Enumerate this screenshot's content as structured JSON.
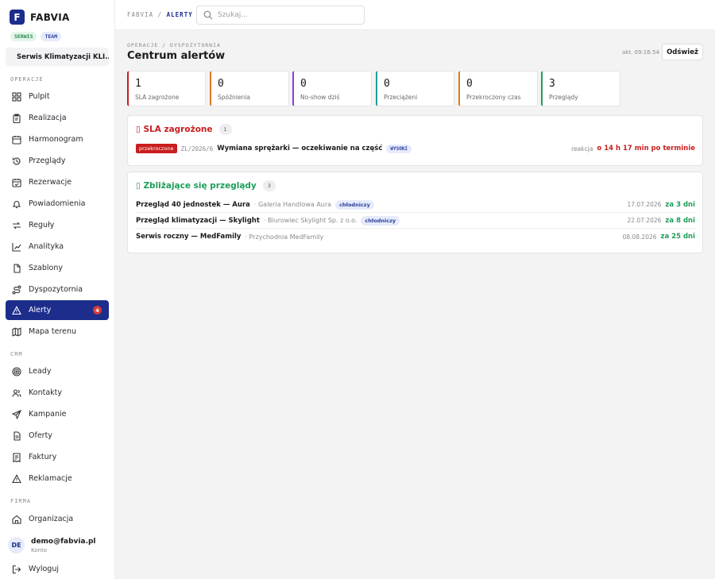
{
  "sidebar": {
    "brand": {
      "logo": "F",
      "name": "FABVIA"
    },
    "tags": [
      "SERWIS",
      "TEAM"
    ],
    "org": "Serwis Klimatyzacji KLI...",
    "sections": {
      "operacje": "OPERACJE",
      "crm": "CRM",
      "firma": "FIRMA"
    },
    "items": [
      {
        "label": "Pulpit",
        "icon": "grid-icon"
      },
      {
        "label": "Realizacja",
        "icon": "clipboard-icon"
      },
      {
        "label": "Harmonogram",
        "icon": "calendar-icon"
      },
      {
        "label": "Przeglądy",
        "icon": "history-icon"
      },
      {
        "label": "Rezerwacje",
        "icon": "calendar-check-icon"
      },
      {
        "label": "Powiadomienia",
        "icon": "bell-icon"
      },
      {
        "label": "Reguły",
        "icon": "rules-icon"
      },
      {
        "label": "Analityka",
        "icon": "chart-icon"
      },
      {
        "label": "Szablony",
        "icon": "template-icon"
      },
      {
        "label": "Dyspozytornia",
        "icon": "route-icon"
      },
      {
        "label": "Alerty",
        "icon": "warning-icon",
        "badge": "4"
      },
      {
        "label": "Mapa terenu",
        "icon": "map-icon"
      },
      {
        "label": "Leady",
        "icon": "target-icon"
      },
      {
        "label": "Kontakty",
        "icon": "users-icon"
      },
      {
        "label": "Kampanie",
        "icon": "send-icon"
      },
      {
        "label": "Oferty",
        "icon": "document-icon"
      },
      {
        "label": "Faktury",
        "icon": "invoice-icon"
      },
      {
        "label": "Reklamacje",
        "icon": "warning-icon"
      },
      {
        "label": "Organizacja",
        "icon": "home-icon"
      }
    ],
    "user": {
      "initials": "DE",
      "email": "demo@fabvia.pl",
      "sub": "Konto"
    },
    "logout": "Wyloguj"
  },
  "topbar": {
    "crumb_root": "FABVIA",
    "crumb_sep": "/",
    "crumb_current": "ALERTY",
    "search_placeholder": "Szukaj..."
  },
  "page": {
    "subcrumb": "OPERACJE / DYSPOZYTORNIA",
    "title": "Centrum alertów",
    "updated": "akt. 09:16:54",
    "refresh": "Odśwież"
  },
  "stats": [
    {
      "value": "1",
      "label": "SLA zagrożone",
      "color": "#c81e1e"
    },
    {
      "value": "0",
      "label": "Spóźnienia",
      "color": "#e07a20"
    },
    {
      "value": "0",
      "label": "No-show dziś",
      "color": "#8a3fd1"
    },
    {
      "value": "0",
      "label": "Przeciążeni",
      "color": "#1aa0a0"
    },
    {
      "value": "0",
      "label": "Przekroczony czas",
      "color": "#e07a20"
    },
    {
      "value": "3",
      "label": "Przeglądy",
      "color": "#1e9e5a"
    }
  ],
  "sla": {
    "icon": "▯",
    "title": "SLA zagrożone",
    "count": "1",
    "rows": [
      {
        "status": "przekroczone",
        "code": "ZL/2026/6",
        "title": "Wymiana sprężarki — oczekiwanie na część",
        "priority": "WYSOKI",
        "meta": "reakcja",
        "delay": "o 14 h 17 min po terminie"
      }
    ]
  },
  "reviews": {
    "icon": "▯",
    "title": "Zbliżające się przeglądy",
    "count": "3",
    "rows": [
      {
        "title": "Przegląd 40 jednostek — Aura",
        "client": "· Galeria Handlowa Aura",
        "chip": "chłodniczy",
        "date": "17.07.2026",
        "due": "za 3 dni"
      },
      {
        "title": "Przegląd klimatyzacji — Skylight",
        "client": "· Biurowiec Skylight Sp. z o.o.",
        "chip": "chłodniczy",
        "date": "22.07.2026",
        "due": "za 8 dni"
      },
      {
        "title": "Serwis roczny — MedFamily",
        "client": "· Przychodnia MedFamily",
        "chip": "",
        "date": "08.08.2026",
        "due": "za 25 dni"
      }
    ]
  }
}
